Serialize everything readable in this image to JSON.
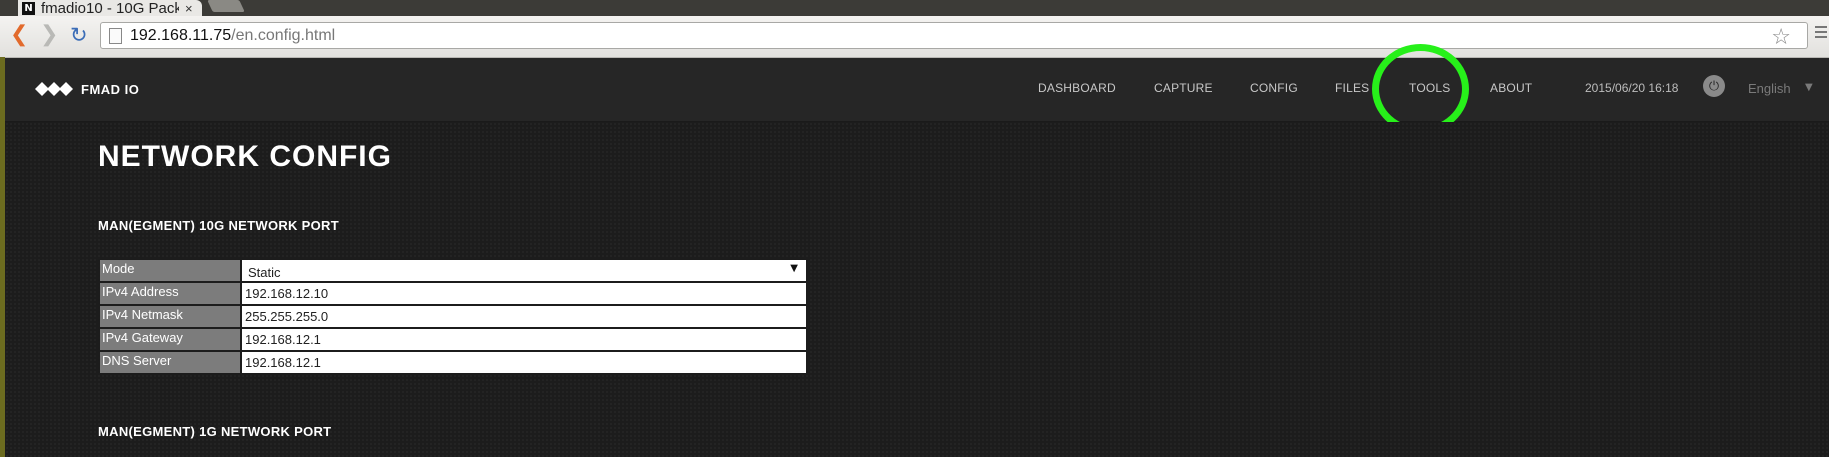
{
  "browser": {
    "tab_title": "fmadio10 - 10G Pack",
    "tab_favicon_letter": "N",
    "tab_close": "×",
    "url_host": "192.168.11.75",
    "url_path": "/en.config.html"
  },
  "header": {
    "logo_text": "FMAD IO",
    "nav": [
      "DASHBOARD",
      "CAPTURE",
      "CONFIG",
      "FILES",
      "TOOLS",
      "ABOUT"
    ],
    "highlighted_nav": "TOOLS",
    "highlight_color": "#27f01a",
    "datetime": "2015/06/20 16:18",
    "language": "English"
  },
  "main": {
    "page_title": "NETWORK CONFIG",
    "section_10g": "MAN(EGMENT) 10G NETWORK PORT",
    "section_1g": "MAN(EGMENT) 1G NETWORK PORT",
    "fields": {
      "mode_label": "Mode",
      "mode_value": "Static",
      "ipv4_address_label": "IPv4 Address",
      "ipv4_address_value": "192.168.12.10",
      "ipv4_netmask_label": "IPv4 Netmask",
      "ipv4_netmask_value": "255.255.255.0",
      "ipv4_gateway_label": "IPv4 Gateway",
      "ipv4_gateway_value": "192.168.12.1",
      "dns_server_label": "DNS Server",
      "dns_server_value": "192.168.12.1"
    }
  }
}
